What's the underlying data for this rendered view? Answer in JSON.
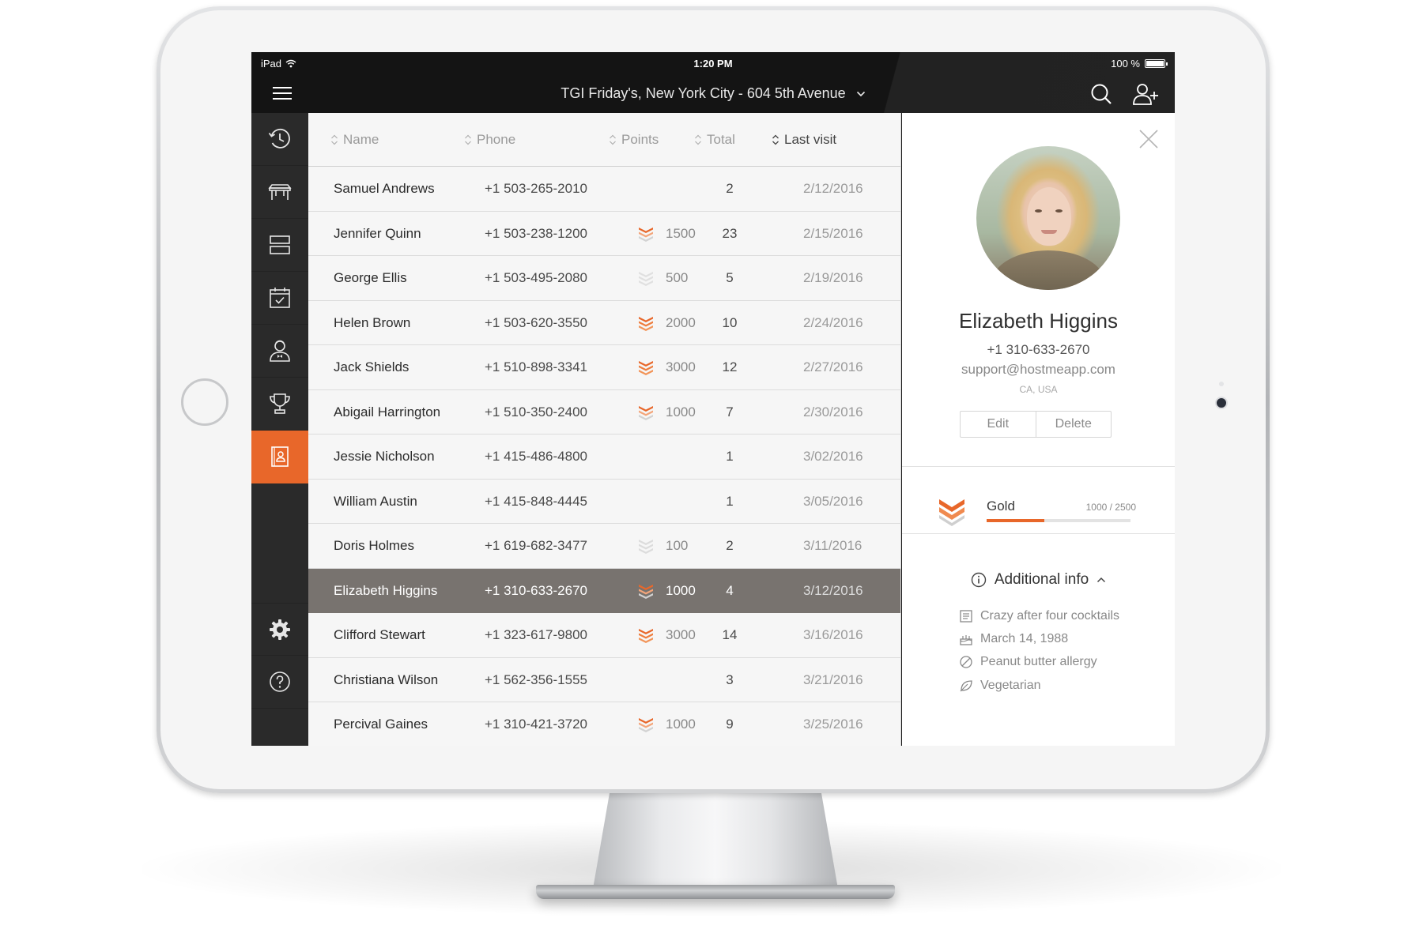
{
  "status_bar": {
    "device": "iPad",
    "time": "1:20 PM",
    "battery": "100 %"
  },
  "nav": {
    "venue": "TGI Friday's, New York City - 604 5th Avenue"
  },
  "sidebar": {
    "items": [
      {
        "icon": "clock-icon",
        "active": false
      },
      {
        "icon": "table-icon",
        "active": false
      },
      {
        "icon": "layout-icon",
        "active": false
      },
      {
        "icon": "calendar-check-icon",
        "active": false
      },
      {
        "icon": "waiter-icon",
        "active": false
      },
      {
        "icon": "trophy-icon",
        "active": false
      },
      {
        "icon": "guestbook-icon",
        "active": true
      }
    ],
    "bottom_items": [
      {
        "icon": "gear-icon"
      },
      {
        "icon": "help-icon"
      }
    ]
  },
  "table": {
    "columns": [
      "Name",
      "Phone",
      "Points",
      "Total",
      "Last visit"
    ],
    "sorted_column": "Last visit",
    "rows": [
      {
        "name": "Samuel Andrews",
        "phone": "+1 503-265-2010",
        "points": "",
        "tier": "none",
        "total": "2",
        "last_visit": "2/12/2016",
        "selected": false
      },
      {
        "name": "Jennifer Quinn",
        "phone": "+1 503-238-1200",
        "points": "1500",
        "tier": "gold",
        "total": "23",
        "last_visit": "2/15/2016",
        "selected": false
      },
      {
        "name": "George Ellis",
        "phone": "+1 503-495-2080",
        "points": "500",
        "tier": "bronze",
        "total": "5",
        "last_visit": "2/19/2016",
        "selected": false
      },
      {
        "name": "Helen Brown",
        "phone": "+1 503-620-3550",
        "points": "2000",
        "tier": "platinum",
        "total": "10",
        "last_visit": "2/24/2016",
        "selected": false
      },
      {
        "name": "Jack Shields",
        "phone": "+1 510-898-3341",
        "points": "3000",
        "tier": "platinum",
        "total": "12",
        "last_visit": "2/27/2016",
        "selected": false
      },
      {
        "name": "Abigail Harrington",
        "phone": "+1 510-350-2400",
        "points": "1000",
        "tier": "gold",
        "total": "7",
        "last_visit": "2/30/2016",
        "selected": false
      },
      {
        "name": "Jessie Nicholson",
        "phone": "+1 415-486-4800",
        "points": "",
        "tier": "none",
        "total": "1",
        "last_visit": "3/02/2016",
        "selected": false
      },
      {
        "name": "William Austin",
        "phone": "+1 415-848-4445",
        "points": "",
        "tier": "none",
        "total": "1",
        "last_visit": "3/05/2016",
        "selected": false
      },
      {
        "name": "Doris Holmes",
        "phone": "+1 619-682-3477",
        "points": "100",
        "tier": "silver",
        "total": "2",
        "last_visit": "3/11/2016",
        "selected": false
      },
      {
        "name": "Elizabeth Higgins",
        "phone": "+1 310-633-2670",
        "points": "1000",
        "tier": "gold",
        "total": "4",
        "last_visit": "3/12/2016",
        "selected": true
      },
      {
        "name": "Clifford Stewart",
        "phone": "+1 323-617-9800",
        "points": "3000",
        "tier": "platinum",
        "total": "14",
        "last_visit": "3/16/2016",
        "selected": false
      },
      {
        "name": "Christiana Wilson",
        "phone": "+1 562-356-1555",
        "points": "",
        "tier": "none",
        "total": "3",
        "last_visit": "3/21/2016",
        "selected": false
      },
      {
        "name": "Percival Gaines",
        "phone": "+1 310-421-3720",
        "points": "1000",
        "tier": "gold",
        "total": "9",
        "last_visit": "3/25/2016",
        "selected": false
      }
    ]
  },
  "detail": {
    "name": "Elizabeth Higgins",
    "phone": "+1 310-633-2670",
    "email": "support@hostmeapp.com",
    "location": "CA, USA",
    "edit_label": "Edit",
    "delete_label": "Delete",
    "loyalty": {
      "tier": "Gold",
      "progress_text": "1000 / 2500",
      "progress": 0.4
    },
    "additional_info_title": "Additional info",
    "additional_info": [
      {
        "icon": "note-icon",
        "text": "Crazy after four cocktails"
      },
      {
        "icon": "birthday-cake-icon",
        "text": "March 14, 1988"
      },
      {
        "icon": "allergy-icon",
        "text": "Peanut butter allergy"
      },
      {
        "icon": "leaf-icon",
        "text": "Vegetarian"
      }
    ]
  },
  "colors": {
    "accent": "#e8672a",
    "selected_row": "#78736f",
    "sidebar": "#2a2a2a"
  }
}
